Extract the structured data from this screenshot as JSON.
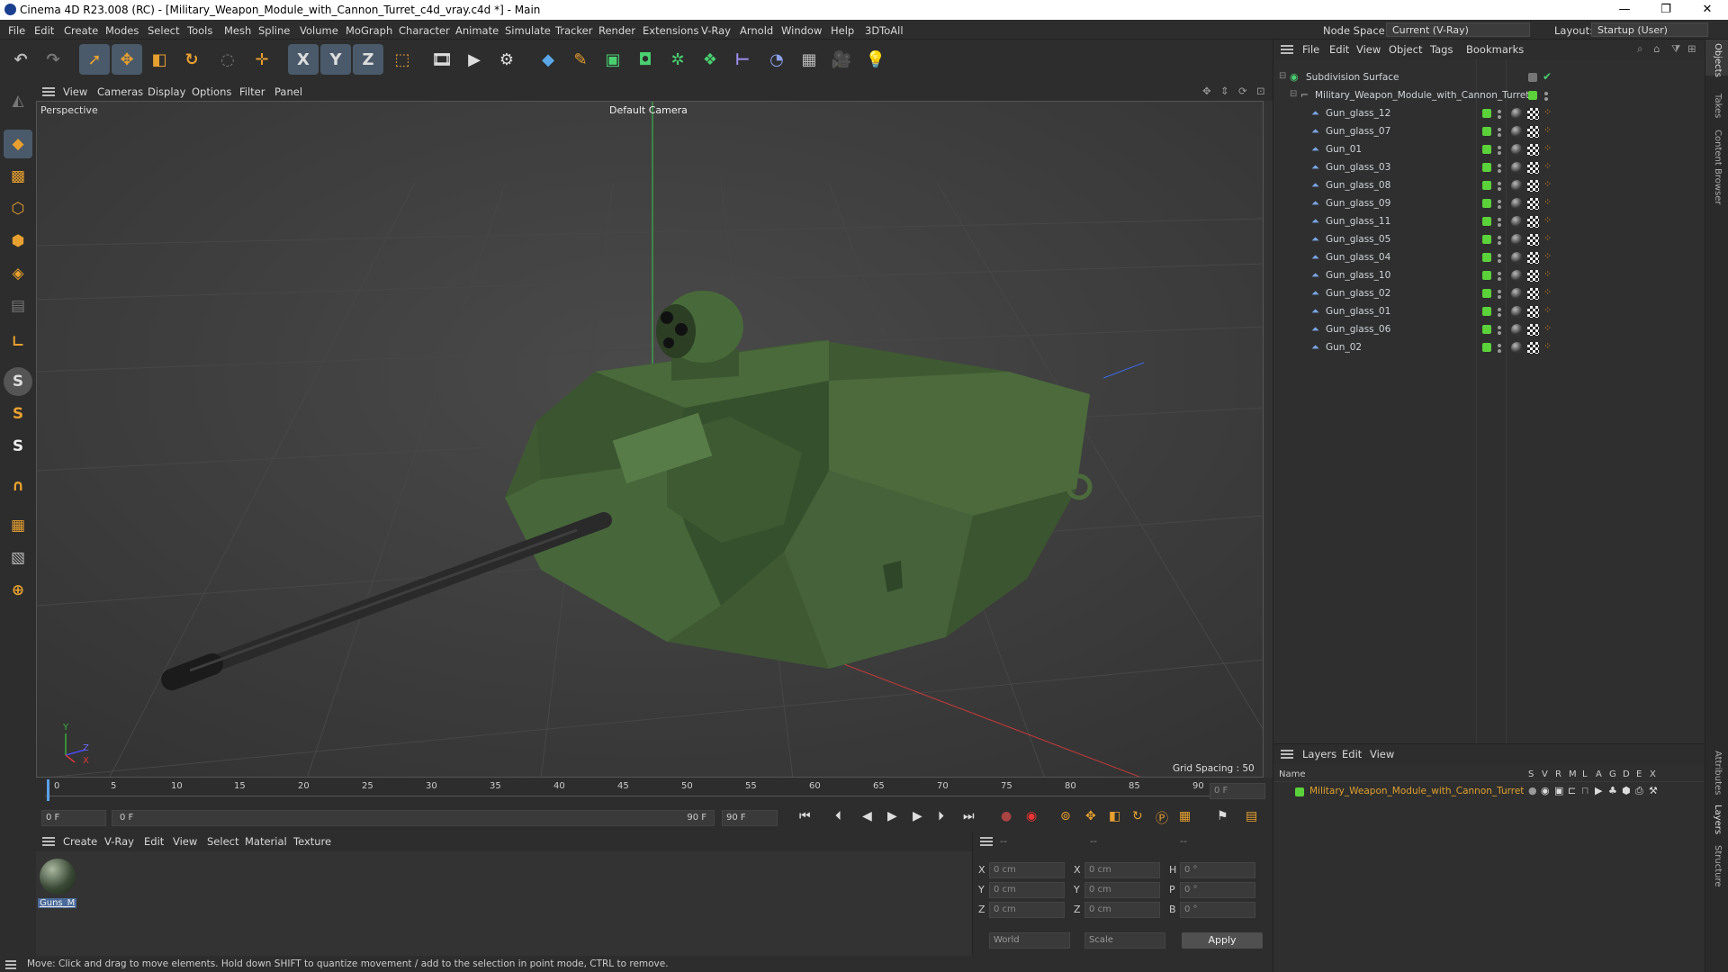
{
  "window": {
    "title": "Cinema 4D R23.008 (RC) - [Military_Weapon_Module_with_Cannon_Turret_c4d_vray.c4d *] - Main",
    "controls": [
      "—",
      "❐",
      "✕"
    ]
  },
  "menubar": {
    "items": [
      "File",
      "Edit",
      "Create",
      "Modes",
      "Select",
      "Tools",
      "Mesh",
      "Spline",
      "Volume",
      "MoGraph",
      "Character",
      "Animate",
      "Simulate",
      "Tracker",
      "Render",
      "Extensions",
      "V-Ray",
      "Arnold",
      "Window",
      "Help",
      "3DToAll"
    ],
    "node_space_label": "Node Space:",
    "node_space_value": "Current (V-Ray)",
    "layout_label": "Layout:",
    "layout_value": "Startup (User)"
  },
  "toolbar": {
    "icons": [
      "undo-icon",
      "redo-icon",
      "select-arrow-icon",
      "move-icon",
      "scale-icon",
      "rotate-icon",
      "recent-icon",
      "transform-icon",
      "x-axis-icon",
      "y-axis-icon",
      "z-axis-icon",
      "coord-system-icon",
      "render-region-icon",
      "render-view-icon",
      "render-settings-icon",
      "cube-icon",
      "pen-icon",
      "subdivision-icon",
      "extrude-icon",
      "cloner-icon",
      "mograph-icon",
      "deformer-icon",
      "field-icon",
      "floor-icon",
      "camera-icon",
      "light-icon"
    ],
    "axis_labels": [
      "X",
      "Y",
      "Z"
    ]
  },
  "left_tools": {
    "icons": [
      "make-editable-icon",
      "model-mode-icon",
      "texture-mode-icon",
      "points-mode-icon",
      "edges-mode-icon",
      "polygons-mode-icon",
      "uv-mode-icon",
      "workplane-icon",
      "snap-icon",
      "snap2-icon",
      "snap3-icon",
      "magnet-icon",
      "grid-icon",
      "hatched-icon",
      "quantize-icon"
    ]
  },
  "viewport": {
    "menu": [
      "View",
      "Cameras",
      "Display",
      "Options",
      "Filter",
      "Panel"
    ],
    "label": "Perspective",
    "camera": "Default Camera",
    "grid_spacing": "Grid Spacing : 50 cm",
    "axis": {
      "y": "Y",
      "z": "Z",
      "x": "X"
    }
  },
  "timeline": {
    "ticks": [
      "0",
      "5",
      "10",
      "15",
      "20",
      "25",
      "30",
      "35",
      "40",
      "45",
      "50",
      "55",
      "60",
      "65",
      "70",
      "75",
      "80",
      "85",
      "90"
    ],
    "current_frame": "0 F"
  },
  "transport": {
    "start": "0 F",
    "range_start": "0 F",
    "range_end": "90 F",
    "end": "90 F"
  },
  "material_manager": {
    "menu": [
      "Create",
      "V-Ray",
      "Edit",
      "View",
      "Select",
      "Material",
      "Texture"
    ],
    "materials": [
      {
        "name": "Guns_M"
      }
    ]
  },
  "coordinates": {
    "headers": [
      "--",
      "--",
      "--"
    ],
    "rows": [
      {
        "a": "X",
        "av": "0 cm",
        "b": "X",
        "bv": "0 cm",
        "c": "H",
        "cv": "0 °"
      },
      {
        "a": "Y",
        "av": "0 cm",
        "b": "Y",
        "bv": "0 cm",
        "c": "P",
        "cv": "0 °"
      },
      {
        "a": "Z",
        "av": "0 cm",
        "b": "Z",
        "bv": "0 cm",
        "c": "B",
        "cv": "0 °"
      }
    ],
    "world": "World",
    "scale": "Scale",
    "apply": "Apply"
  },
  "status": "Move: Click and drag to move elements. Hold down SHIFT to quantize movement / add to the selection in point mode, CTRL to remove.",
  "object_manager": {
    "menu": [
      "File",
      "Edit",
      "View",
      "Object",
      "Tags",
      "Bookmarks"
    ],
    "root": "Subdivision Surface",
    "group": "Military_Weapon_Module_with_Cannon_Turret",
    "objects": [
      "Gun_glass_12",
      "Gun_glass_07",
      "Gun_01",
      "Gun_glass_03",
      "Gun_glass_08",
      "Gun_glass_09",
      "Gun_glass_11",
      "Gun_glass_05",
      "Gun_glass_04",
      "Gun_glass_10",
      "Gun_glass_02",
      "Gun_glass_01",
      "Gun_glass_06",
      "Gun_02"
    ]
  },
  "layers": {
    "menu": [
      "Layers",
      "Edit",
      "View"
    ],
    "name_header": "Name",
    "col_headers": [
      "S",
      "V",
      "R",
      "M",
      "L",
      "A",
      "G",
      "D",
      "E",
      "X"
    ],
    "items": [
      "Military_Weapon_Module_with_Cannon_Turret"
    ]
  },
  "right_tabs": [
    "Objects",
    "Takes",
    "Content Browser",
    "Attributes",
    "Layers",
    "Structure"
  ],
  "colors": {
    "accent": "#e48a1e",
    "layer_text": "#e0a02e",
    "green": "#5bd13a",
    "axis_x": "#4a4af0",
    "axis_y": "#3ab03a",
    "axis_z": "#d93a3a"
  }
}
